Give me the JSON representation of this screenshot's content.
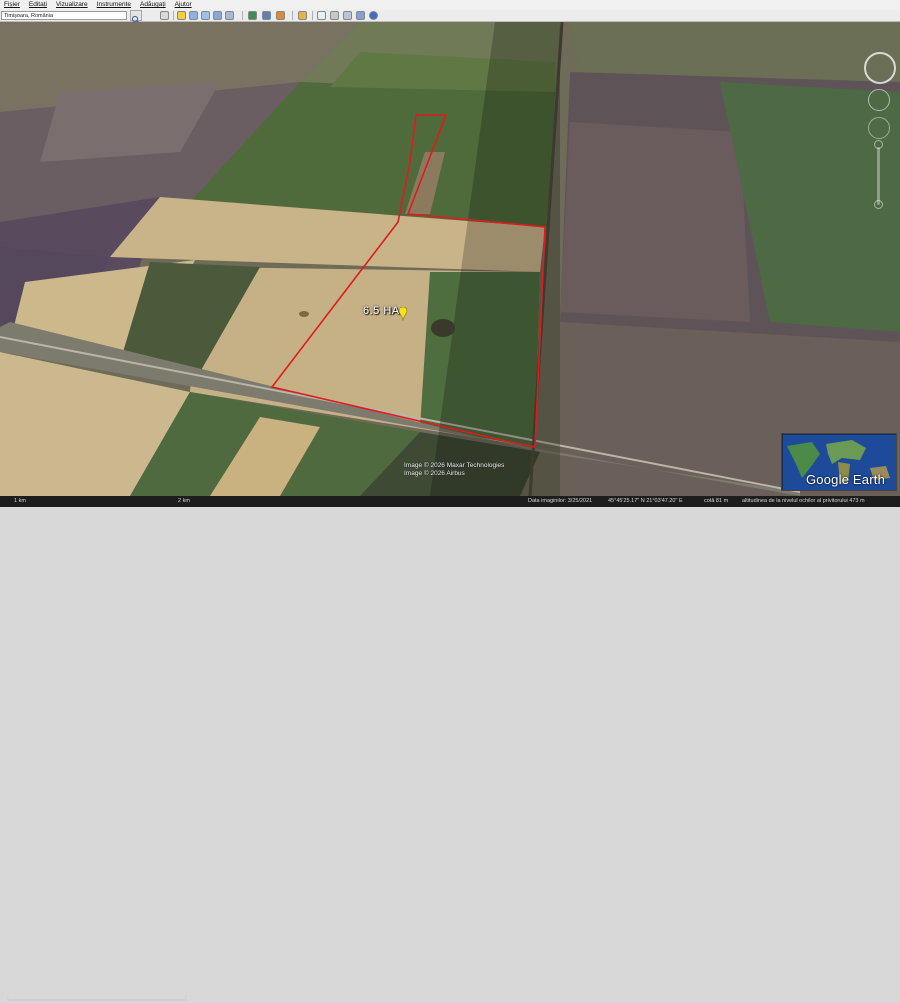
{
  "menu": {
    "items": [
      "Fișier",
      "Editați",
      "Vizualizare",
      "Instrumente",
      "Adăugați",
      "Ajutor"
    ]
  },
  "search": {
    "value": "Timișoara, România"
  },
  "toolbar": {
    "icons": [
      "hide-sidebar-icon",
      "placemark-icon",
      "polygon-icon",
      "path-icon",
      "image-overlay-icon",
      "record-tour-icon",
      "historical-imagery-icon",
      "sunlight-icon",
      "planets-icon",
      "ruler-icon",
      "email-icon",
      "print-icon",
      "save-image-icon",
      "google-maps-icon"
    ]
  },
  "map": {
    "parcel_label": "6.5 HA",
    "parcel_color": "#e01b1b",
    "attribution_1": "Image © 2026 Maxar Technologies",
    "attribution_2": "Image © 2026 Airbus"
  },
  "status": {
    "scale_left": "1 km",
    "scale_right": "2 km",
    "imagery_date": "Data imaginilor:  3/25/2021",
    "coords": "45°45'25.17\" N   21°03'47.20\" E",
    "elevation": "cotă    81 m",
    "eye_alt": "altitudinea de la nivelul ochilor al privitorului    473 m"
  },
  "branding": {
    "logo": "Google Earth"
  }
}
